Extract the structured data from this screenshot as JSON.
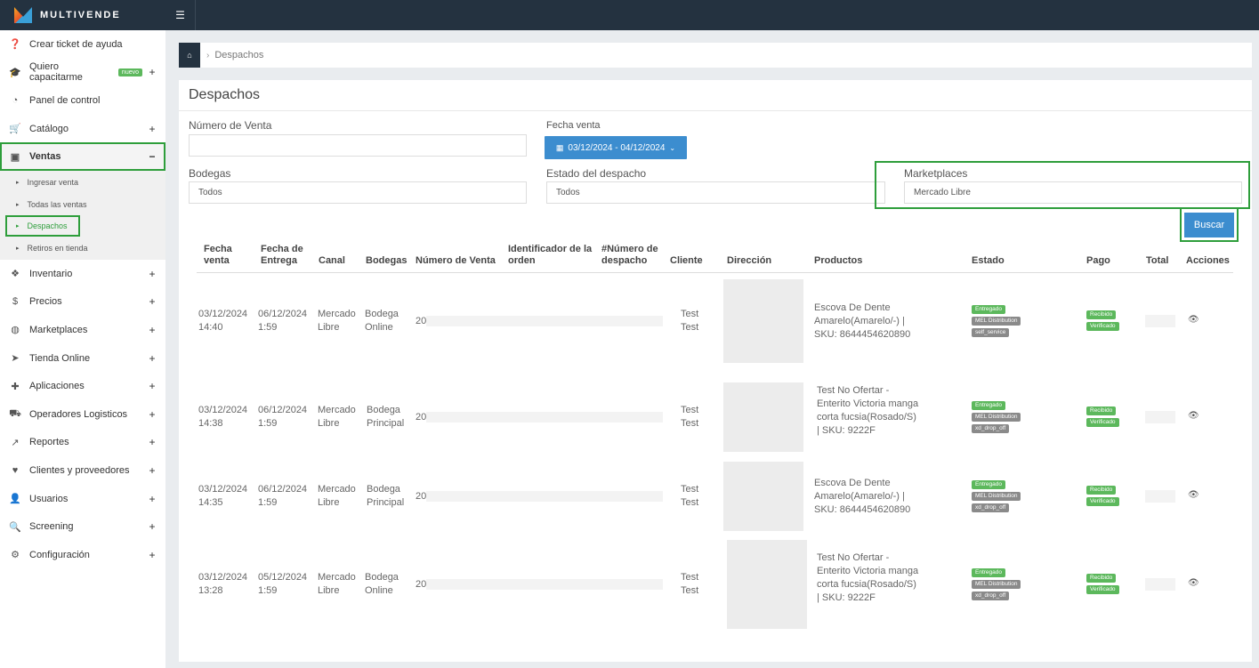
{
  "app": {
    "logo_text": "MULTIVENDE"
  },
  "sidebar": {
    "items": [
      {
        "label": "Crear ticket de ayuda",
        "icon": "question-icon",
        "glyph": "❓",
        "plus": ""
      },
      {
        "label": "Quiero capacitarme",
        "icon": "graduation-cap-icon",
        "glyph": "🎓",
        "plus": "+",
        "badge": "nuevo"
      },
      {
        "label": "Panel de control",
        "icon": "dashboard-icon",
        "glyph": "◔",
        "plus": ""
      },
      {
        "label": "Catálogo",
        "icon": "cart-icon",
        "glyph": "🛒",
        "plus": "+"
      },
      {
        "label": "Ventas",
        "icon": "money-icon",
        "glyph": "▣",
        "plus": "−"
      }
    ],
    "ventas_sub": [
      {
        "label": "Ingresar venta"
      },
      {
        "label": "Todas las ventas"
      },
      {
        "label": "Despachos"
      },
      {
        "label": "Retiros en tienda"
      }
    ],
    "items_after": [
      {
        "label": "Inventario",
        "icon": "cubes-icon",
        "glyph": "❖",
        "plus": "+"
      },
      {
        "label": "Precios",
        "icon": "dollar-icon",
        "glyph": "$",
        "plus": "+"
      },
      {
        "label": "Marketplaces",
        "icon": "globe-icon",
        "glyph": "◍",
        "plus": "+"
      },
      {
        "label": "Tienda Online",
        "icon": "pointer-icon",
        "glyph": "➤",
        "plus": "+"
      },
      {
        "label": "Aplicaciones",
        "icon": "puzzle-icon",
        "glyph": "✚",
        "plus": "+"
      },
      {
        "label": "Operadores Logisticos",
        "icon": "truck-icon",
        "glyph": "⛟",
        "plus": "+"
      },
      {
        "label": "Reportes",
        "icon": "chart-icon",
        "glyph": "↗",
        "plus": "+"
      },
      {
        "label": "Clientes y proveedores",
        "icon": "heart-icon",
        "glyph": "♥",
        "plus": "+"
      },
      {
        "label": "Usuarios",
        "icon": "user-icon",
        "glyph": "👤",
        "plus": "+"
      },
      {
        "label": "Screening",
        "icon": "search-icon",
        "glyph": "🔍",
        "plus": "+"
      },
      {
        "label": "Configuración",
        "icon": "gear-icon",
        "glyph": "⚙",
        "plus": "+"
      }
    ]
  },
  "breadcrumb": {
    "current": "Despachos"
  },
  "page": {
    "title": "Despachos",
    "filters": {
      "numero_venta_label": "Número de Venta",
      "numero_venta_value": "",
      "fecha_venta_label": "Fecha venta",
      "fecha_venta_value": "03/12/2024 - 04/12/2024",
      "bodegas_label": "Bodegas",
      "bodegas_value": "Todos",
      "estado_label": "Estado del despacho",
      "estado_value": "Todos",
      "marketplaces_label": "Marketplaces",
      "marketplaces_value": "Mercado Libre",
      "search_button": "Buscar"
    }
  },
  "table": {
    "headers": [
      "Fecha venta",
      "Fecha de Entrega",
      "Canal",
      "Bodegas",
      "Número de Venta",
      "Identificador de la orden",
      "#Número de despacho",
      "Cliente",
      "Dirección",
      "Productos",
      "Estado",
      "Pago",
      "Total",
      "Acciones"
    ],
    "rows": [
      {
        "fecha_venta": "03/12/2024 14:40",
        "fecha_entrega": "06/12/2024 1:59",
        "canal": "Mercado Libre",
        "bodega": "Bodega Online",
        "numero_venta": "20",
        "cliente": "Test Test",
        "producto": "Escova De Dente Amarelo(Amarelo/-) | SKU: 8644454620890",
        "estado_tags": [
          "Entregado",
          "MEL Distribution",
          "self_service"
        ],
        "pago_tags": [
          "Recibido",
          "Verificado"
        ]
      },
      {
        "fecha_venta": "03/12/2024 14:38",
        "fecha_entrega": "06/12/2024 1:59",
        "canal": "Mercado Libre",
        "bodega": "Bodega Principal",
        "numero_venta": "20",
        "cliente": "Test Test",
        "producto": "Test No Ofertar - Enterito Victoria manga corta fucsia(Rosado/S) | SKU: 9222F",
        "estado_tags": [
          "Entregado",
          "MEL Distribution",
          "xd_drop_off"
        ],
        "pago_tags": [
          "Recibido",
          "Verificado"
        ]
      },
      {
        "fecha_venta": "03/12/2024 14:35",
        "fecha_entrega": "06/12/2024 1:59",
        "canal": "Mercado Libre",
        "bodega": "Bodega Principal",
        "numero_venta": "20",
        "cliente": "Test Test",
        "producto": "Escova De Dente Amarelo(Amarelo/-) | SKU: 8644454620890",
        "estado_tags": [
          "Entregado",
          "MEL Distribution",
          "xd_drop_off"
        ],
        "pago_tags": [
          "Recibido",
          "Verificado"
        ]
      },
      {
        "fecha_venta": "03/12/2024 13:28",
        "fecha_entrega": "05/12/2024 1:59",
        "canal": "Mercado Libre",
        "bodega": "Bodega Online",
        "numero_venta": "20",
        "cliente": "Test Test",
        "producto": "Test No Ofertar - Enterito Victoria manga corta fucsia(Rosado/S) | SKU: 9222F",
        "estado_tags": [
          "Entregado",
          "MEL Distribution",
          "xd_drop_off"
        ],
        "pago_tags": [
          "Recibido",
          "Verificado"
        ]
      }
    ]
  },
  "colors": {
    "topbar": "#243240",
    "accent": "#3c8dcf",
    "highlight": "#2e9e3b",
    "tag_green": "#5cb85c",
    "tag_gray": "#8a8a8a"
  }
}
